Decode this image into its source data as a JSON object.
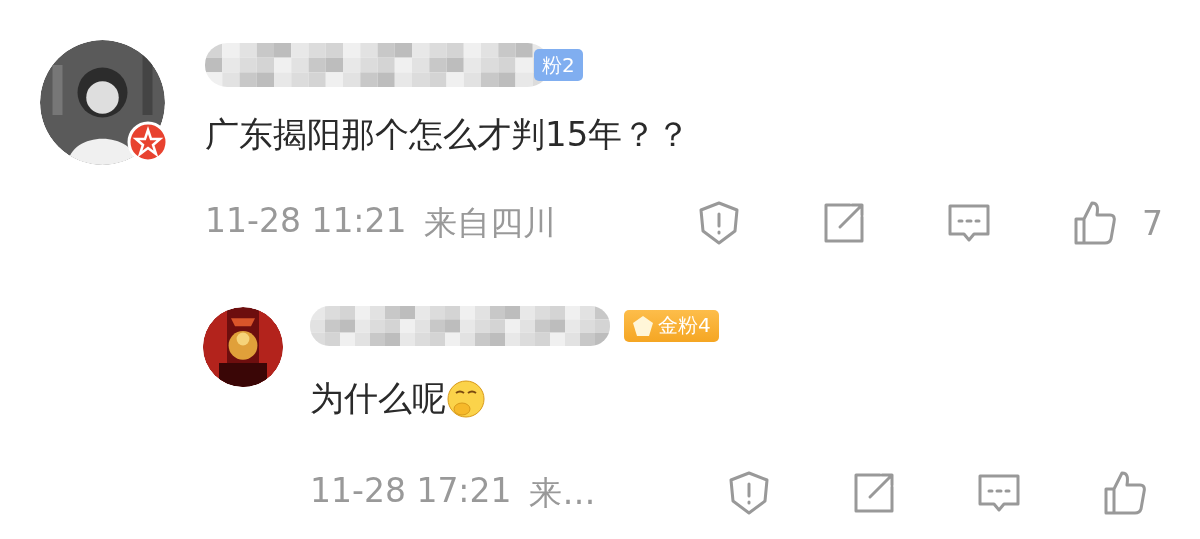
{
  "comments": [
    {
      "kind": "comment",
      "avatar": {
        "verified": true
      },
      "badge": {
        "kind": "iron",
        "label": "粉2"
      },
      "text": "广东揭阳那个怎么才判15年？？",
      "emoji": false,
      "time": "11-28 11:21",
      "location": "来自四川",
      "likes": "7"
    },
    {
      "kind": "reply",
      "avatar": {
        "verified": false
      },
      "badge": {
        "kind": "gold",
        "label": "金粉4"
      },
      "text": "为什么呢",
      "emoji": true,
      "time": "11-28 17:21",
      "location": "来…"
    }
  ]
}
